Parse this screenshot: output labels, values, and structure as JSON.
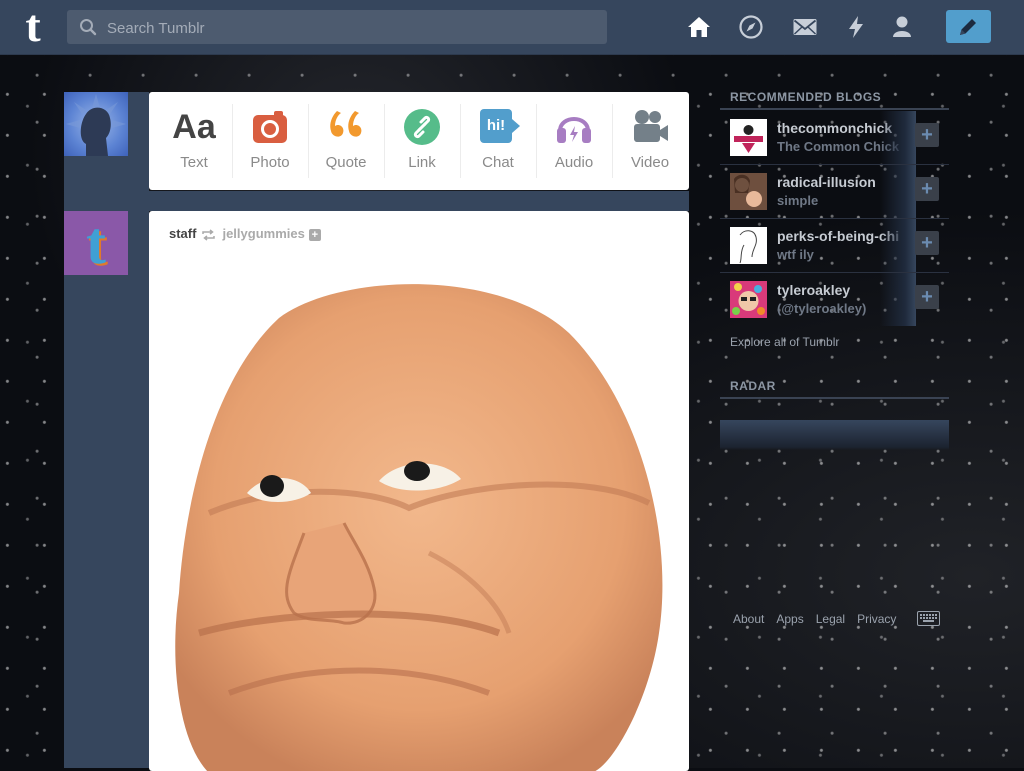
{
  "topbar": {
    "logo_letter": "t",
    "search_placeholder": "Search Tumblr",
    "nav": [
      "home-icon",
      "explore-compass-icon",
      "messages-icon",
      "activity-bolt-icon",
      "account-icon"
    ],
    "compose_icon": "pencil-icon",
    "accent": "#529ecc"
  },
  "post_types": [
    {
      "label": "Text",
      "icon": "Aa",
      "color": "#444444"
    },
    {
      "label": "Photo",
      "icon": "camera-icon",
      "color": "#d95e40"
    },
    {
      "label": "Quote",
      "icon": "quote-icon",
      "color": "#f2992e"
    },
    {
      "label": "Link",
      "icon": "link-icon",
      "color": "#56bc8a"
    },
    {
      "label": "Chat",
      "icon": "hi!",
      "color": "#529ecc"
    },
    {
      "label": "Audio",
      "icon": "headphones-icon",
      "color": "#a77dc2"
    },
    {
      "label": "Video",
      "icon": "video-camera-icon",
      "color": "#748089"
    }
  ],
  "post": {
    "author": "staff",
    "reblogged_from": "jellygummies",
    "follow_symbol": "+"
  },
  "sidebar": {
    "recommended_title": "RECOMMENDED BLOGS",
    "blogs": [
      {
        "name": "thecommonchick",
        "title": "The Common Chick"
      },
      {
        "name": "radical-illusion",
        "title": "simple"
      },
      {
        "name": "perks-of-being-chi",
        "title": "wtf ily"
      },
      {
        "name": "tyleroakley",
        "title": "(@tyleroakley)"
      }
    ],
    "follow_symbol": "+",
    "explore_label": "Explore all of Tumblr",
    "radar_title": "RADAR"
  },
  "footer": {
    "links": [
      "About",
      "Apps",
      "Legal",
      "Privacy"
    ],
    "keyboard_icon": "keyboard-icon"
  }
}
